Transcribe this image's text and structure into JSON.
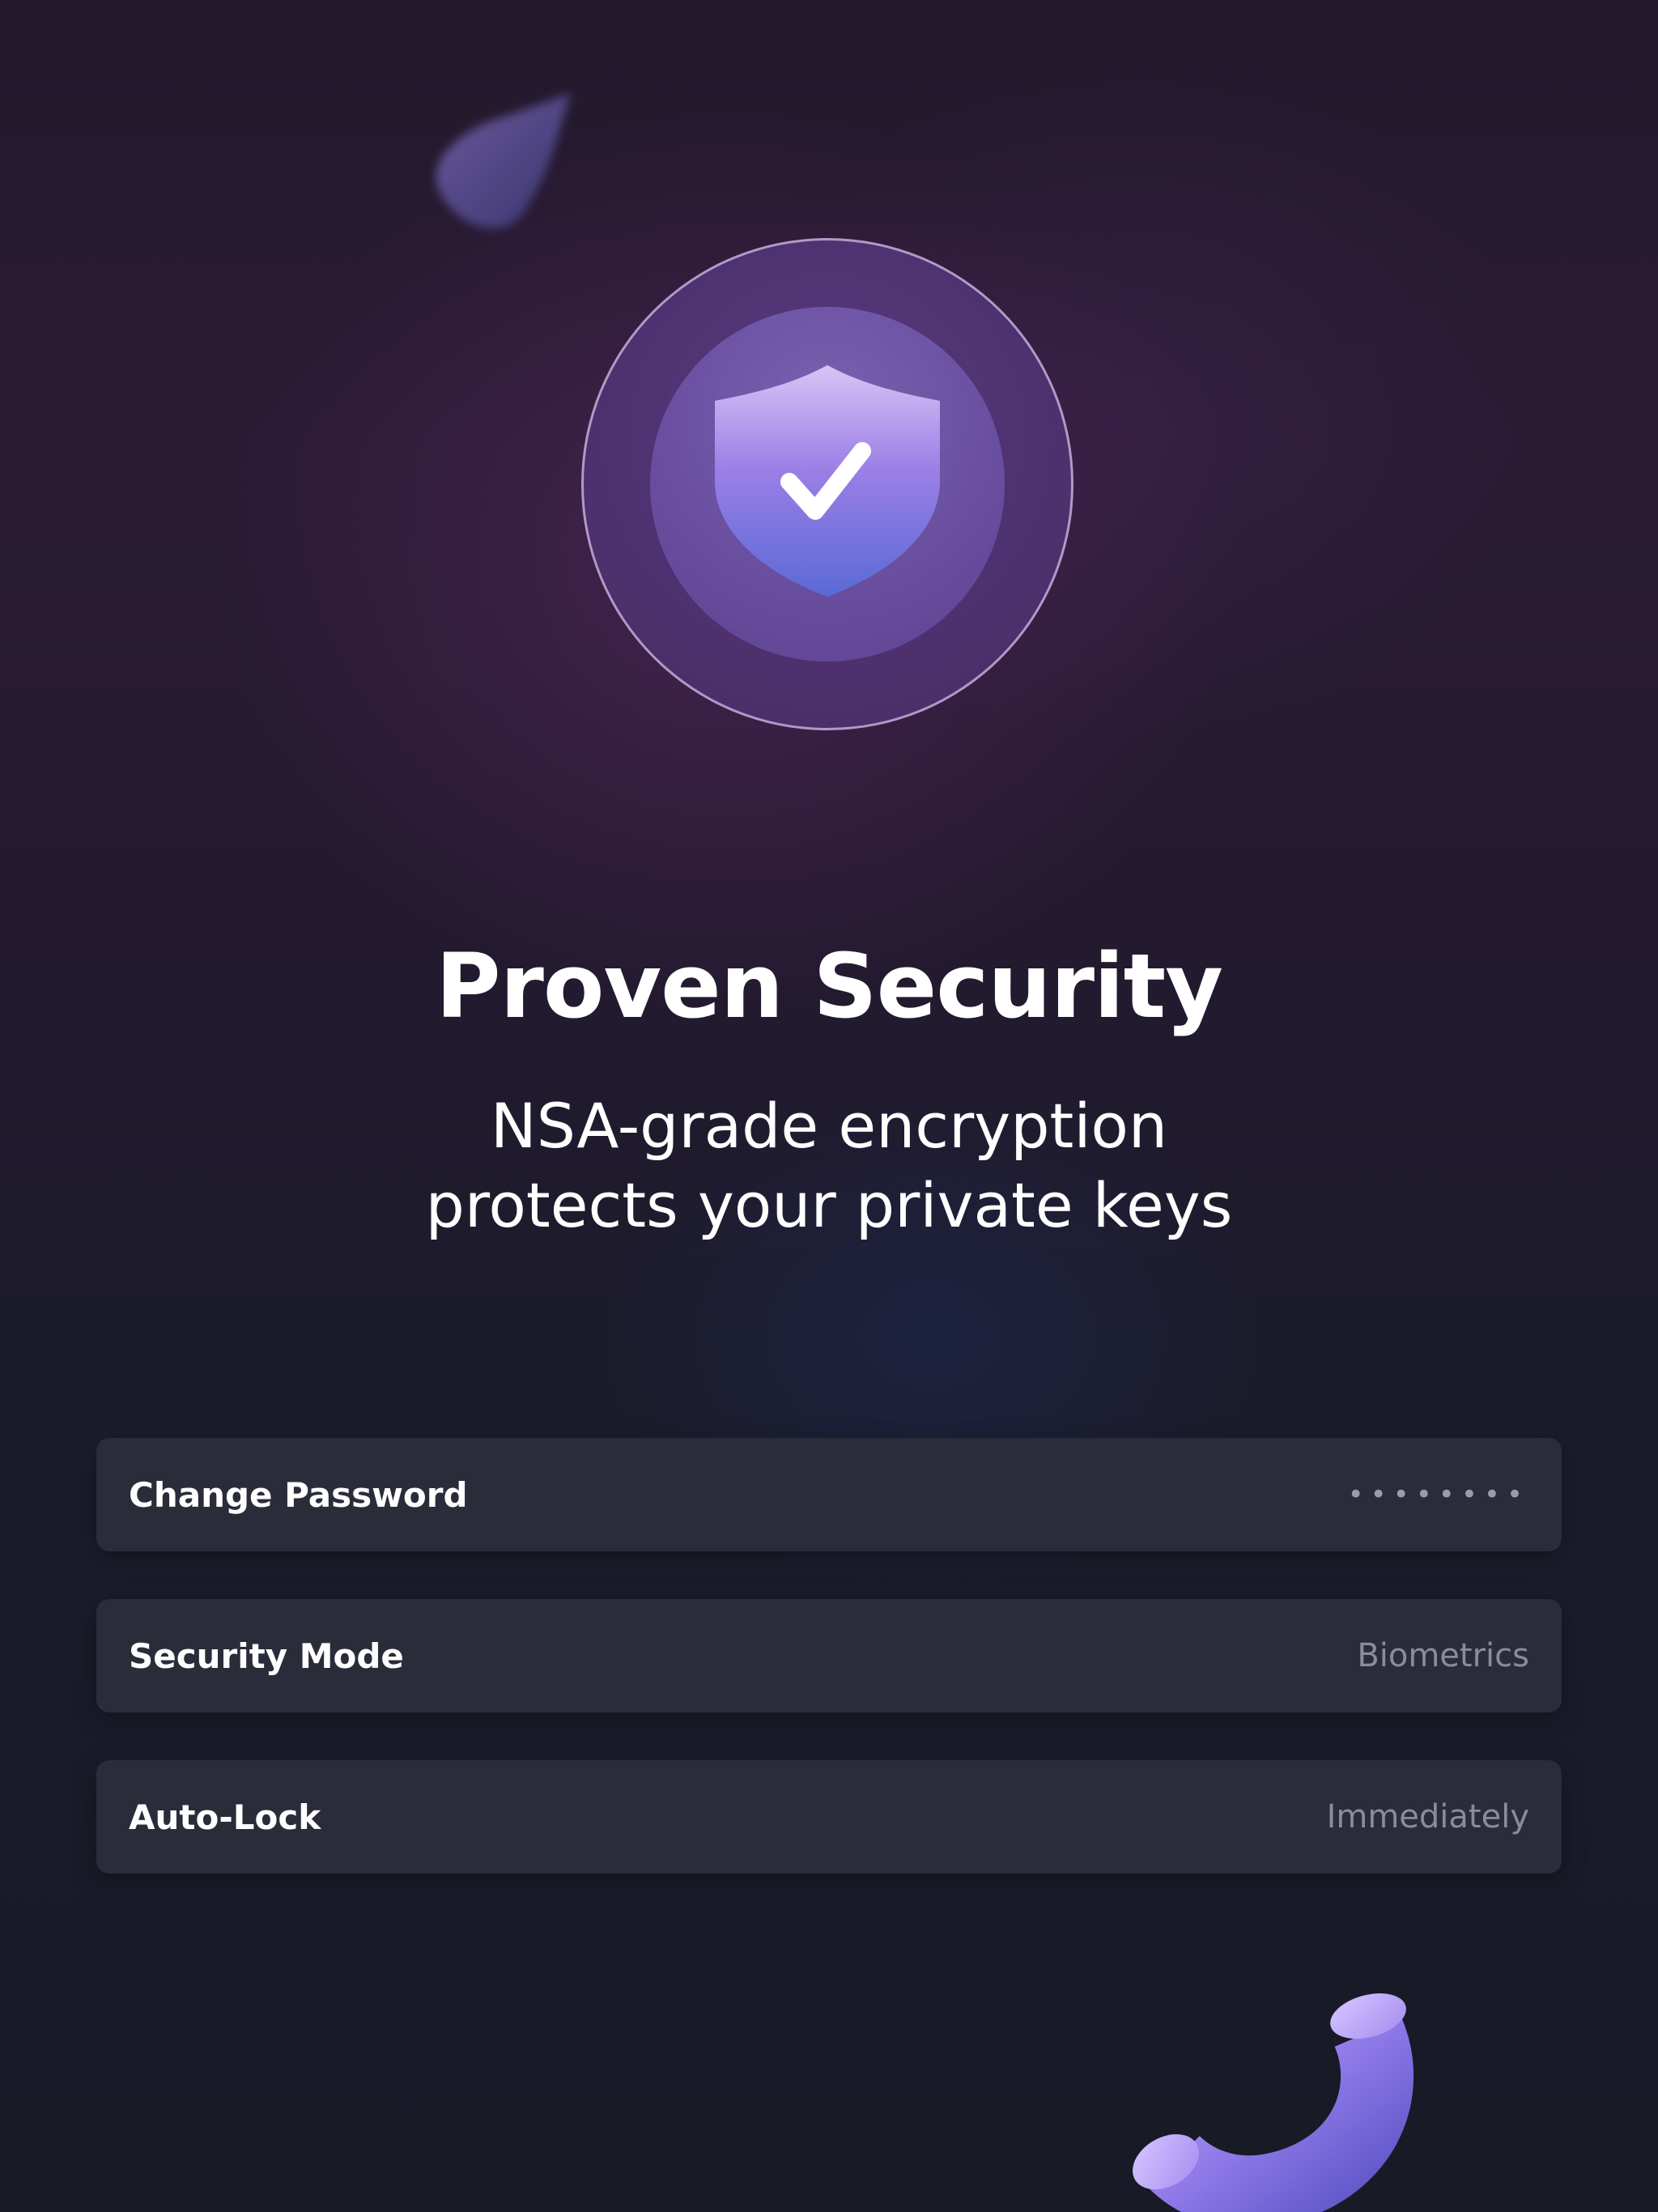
{
  "hero": {
    "icon": "shield-check-icon"
  },
  "title": "Proven Security",
  "subtitle": {
    "line1": "NSA-grade encryption",
    "line2": "protects your private keys"
  },
  "settings": [
    {
      "label": "Change Password",
      "value": "••••••••"
    },
    {
      "label": "Security Mode",
      "value": "Biometrics"
    },
    {
      "label": "Auto-Lock",
      "value": "Immediately"
    }
  ],
  "colors": {
    "accent": "#8a6fe0",
    "background": "#1a1b27",
    "card": "#2a2c3a"
  }
}
